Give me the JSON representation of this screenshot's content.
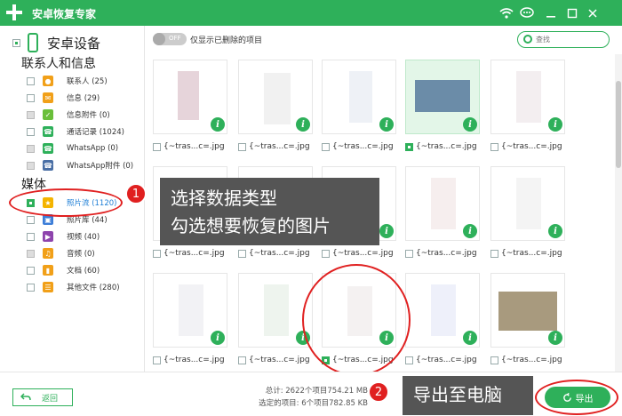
{
  "app": {
    "title": "安卓恢复专家"
  },
  "titlebar": {
    "icons": [
      "wifi-icon",
      "chat-icon",
      "minimize-icon",
      "maximize-icon",
      "close-icon"
    ]
  },
  "sidebar": {
    "device": "安卓设备",
    "contacts_section": "联系人和信息",
    "media_section": "媒体",
    "contacts_items": [
      {
        "label": "联系人 (25)",
        "icon": "contacts-icon",
        "color": "#f1a019"
      },
      {
        "label": "信息 (29)",
        "icon": "messages-icon",
        "color": "#f1a019"
      },
      {
        "label": "信息附件 (0)",
        "icon": "attachment-icon",
        "color": "#6abf3a"
      },
      {
        "label": "通话记录 (1024)",
        "icon": "call-log-icon",
        "color": "#2eb05a"
      },
      {
        "label": "WhatsApp (0)",
        "icon": "whatsapp-icon",
        "color": "#2eb05a"
      },
      {
        "label": "WhatsApp附件 (0)",
        "icon": "whatsapp-attachment-icon",
        "color": "#4a6fa5"
      }
    ],
    "media_items": [
      {
        "label": "照片流 (1120)",
        "icon": "photo-stream-icon",
        "color": "#f4b400"
      },
      {
        "label": "照片库 (44)",
        "icon": "photo-library-icon",
        "color": "#3b7dd8"
      },
      {
        "label": "视频 (40)",
        "icon": "video-icon",
        "color": "#8e44ad"
      },
      {
        "label": "音频 (0)",
        "icon": "audio-icon",
        "color": "#f1a019"
      },
      {
        "label": "文档 (60)",
        "icon": "document-icon",
        "color": "#f1a019"
      },
      {
        "label": "其他文件 (280)",
        "icon": "other-files-icon",
        "color": "#f1a019"
      }
    ]
  },
  "filter": {
    "toggle": "OFF",
    "only_deleted": "仅显示已删除的项目",
    "search_placeholder": "查找"
  },
  "files": [
    {
      "name": "{~tras...c=.jpg",
      "checked": false,
      "selected": false
    },
    {
      "name": "{~tras...c=.jpg",
      "checked": false,
      "selected": false
    },
    {
      "name": "{~tras...c=.jpg",
      "checked": false,
      "selected": false
    },
    {
      "name": "{~tras...c=.jpg",
      "checked": true,
      "selected": true
    },
    {
      "name": "{~tras...c=.jpg",
      "checked": false,
      "selected": false
    },
    {
      "name": "{~tras...c=.jpg",
      "checked": false,
      "selected": false
    },
    {
      "name": "{~tras...c=.jpg",
      "checked": false,
      "selected": false
    },
    {
      "name": "{~tras...c=.jpg",
      "checked": false,
      "selected": false
    },
    {
      "name": "{~tras...c=.jpg",
      "checked": false,
      "selected": false
    },
    {
      "name": "{~tras...c=.jpg",
      "checked": false,
      "selected": false
    },
    {
      "name": "{~tras...c=.jpg",
      "checked": false,
      "selected": false
    },
    {
      "name": "{~tras...c=.jpg",
      "checked": false,
      "selected": false
    },
    {
      "name": "{~tras...c=.jpg",
      "checked": true,
      "selected": false
    },
    {
      "name": "{~tras...c=.jpg",
      "checked": false,
      "selected": false
    },
    {
      "name": "{~tras...c=.jpg",
      "checked": false,
      "selected": false
    }
  ],
  "annotations": {
    "step1_number": "1",
    "step1_line1": "选择数据类型",
    "step1_line2": "勾选想要恢复的图片",
    "step2_number": "2",
    "step2_text": "导出至电脑",
    "color": "#e02020"
  },
  "footer": {
    "back": "返回",
    "total": "总计: 2622个项目754.21 MB",
    "selected": "选定的项目: 6个项目782.85 KB",
    "export": "导出"
  },
  "colors": {
    "accent": "#2eb05a"
  }
}
